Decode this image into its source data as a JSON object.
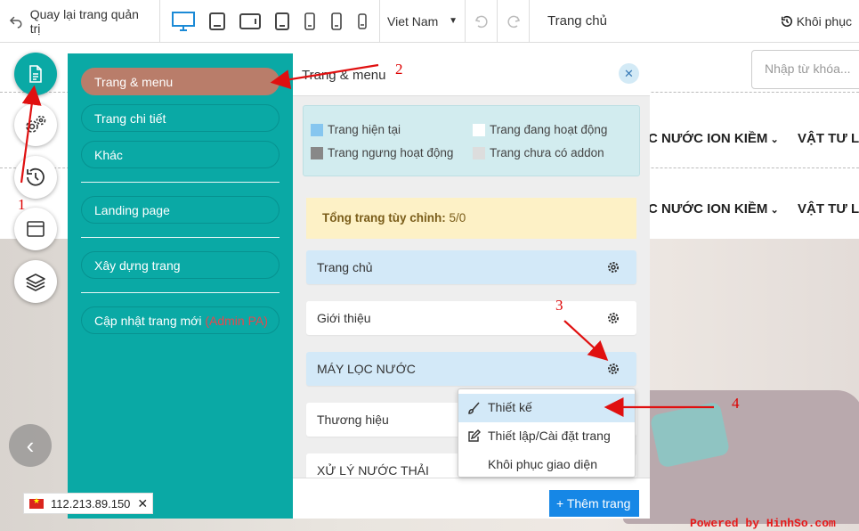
{
  "topbar": {
    "back_label": "Quay lại trang quản trị",
    "language": "Viet Nam",
    "page_title": "Trang chủ",
    "restore_label": "Khôi phục"
  },
  "website": {
    "search_placeholder": "Nhập từ khóa...",
    "nav_item_1": "C NƯỚC ION KIỀM",
    "nav_item_2": "VẬT TƯ LI"
  },
  "side_menu": {
    "items": [
      {
        "label": "Trang & menu"
      },
      {
        "label": "Trang chi tiết"
      },
      {
        "label": "Khác"
      },
      {
        "label": "Landing page"
      },
      {
        "label": "Xây dựng trang"
      },
      {
        "label": "Cập nhật trang mới"
      }
    ],
    "admin_tag": "(Admin PA)"
  },
  "pages_panel": {
    "title": "Trang & menu",
    "legend": {
      "current": "Trang hiện tại",
      "active": "Trang đang hoạt động",
      "inactive": "Trang ngưng hoạt động",
      "no_addon": "Trang chưa có addon"
    },
    "total_label": "Tổng trang tùy chỉnh:",
    "total_value": "5/0",
    "pages": [
      {
        "name": "Trang chủ"
      },
      {
        "name": "Giới thiệu"
      },
      {
        "name": "MÁY LỌC NƯỚC"
      },
      {
        "name": "Thương hiệu"
      },
      {
        "name": "XỬ LÝ NƯỚC THẢI"
      }
    ],
    "add_button": "Thêm trang"
  },
  "context_menu": {
    "design": "Thiết kế",
    "settings": "Thiết lập/Cài đặt trang",
    "restore_theme": "Khôi phục giao diện"
  },
  "ip_badge": {
    "ip": "112.213.89.150"
  },
  "annotations": {
    "n1": "1",
    "n2": "2",
    "n3": "3",
    "n4": "4"
  },
  "watermark": "Powered by HinhSo.com",
  "colors": {
    "teal": "#0aa9a5",
    "active_item": "#b97d6a",
    "blue_button": "#1687e6",
    "arrow": "#e01010"
  }
}
